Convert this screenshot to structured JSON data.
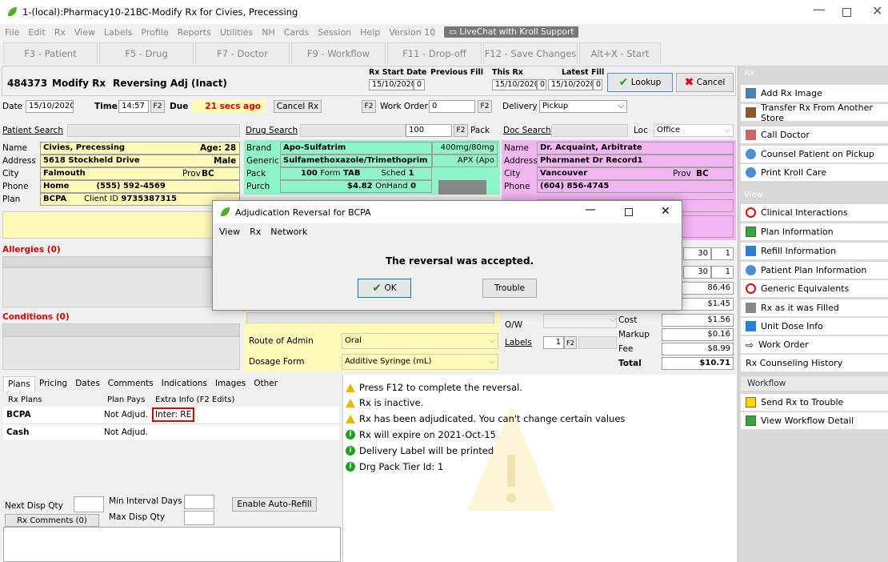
{
  "window": {
    "title": "1-(local):Pharmacy10-21BC-Modify Rx for Civies, Precessing"
  },
  "menu": [
    "File",
    "Edit",
    "Rx",
    "View",
    "Labels",
    "Profile",
    "Reports",
    "Utilities",
    "NH",
    "Cards",
    "Session",
    "Help",
    "Version 10"
  ],
  "livechat": "LiveChat with Kroll Support",
  "fkeys": [
    "F3 - Patient",
    "F5 - Drug",
    "F7 - Doctor",
    "F9 - Workflow",
    "F11 - Drop-off",
    "F12 - Save Changes",
    "Alt+X - Start"
  ],
  "header": {
    "rxnum": "484373",
    "mode": "Modify Rx",
    "status": "Reversing Adj (Inact)",
    "rx_start_label": "Rx Start Date",
    "rx_start": "15/10/2020",
    "rx_start_n": "0",
    "prev_fill_label": "Previous Fill",
    "this_rx_label": "This Rx",
    "this_rx": "15/10/2020",
    "this_rx_n": "0",
    "latest_fill_label": "Latest Fill",
    "latest_fill": "15/10/2020",
    "latest_fill_n": "0",
    "lookup": "Lookup",
    "cancel": "Cancel"
  },
  "row2": {
    "date_label": "Date",
    "date": "15/10/2020",
    "time_label": "Time",
    "time": "14:57",
    "f2": "F2",
    "due_label": "Due",
    "due": "21 secs ago",
    "cancel_rx": "Cancel Rx",
    "work_order_label": "Work Order",
    "work_order": "0",
    "delivery_label": "Delivery",
    "delivery": "Pickup"
  },
  "patient": {
    "search": "Patient Search",
    "name_label": "Name",
    "name": "Civies, Precessing",
    "age": "Age: 28",
    "address_label": "Address",
    "address": "5618 Stockheld Drive",
    "sex": "Male",
    "city_label": "City",
    "city": "Falmouth",
    "prov_label": "Prov",
    "prov": "BC",
    "phone_label": "Phone",
    "phone_type": "Home",
    "phone": "(555) 592-4569",
    "plan_label": "Plan",
    "plan": "BCPA",
    "client_label": "Client ID",
    "client_id": "9735387315"
  },
  "allergies": "Allergies (0)",
  "conditions": "Conditions (0)",
  "drug": {
    "search": "Drug Search",
    "qty": "100",
    "f2": "F2",
    "pack_label": "Pack",
    "brand_label": "Brand",
    "brand": "Apo-Sulfatrim",
    "strength": "400mg/80mg",
    "generic_label": "Generic",
    "generic": "Sulfamethoxazole/Trimethoprim",
    "apx": "APX (Apo",
    "pack2_label": "Pack",
    "pack_size": "100",
    "form_label": "Form",
    "form": "TAB",
    "sched_label": "Sched",
    "sched": "1",
    "purch_label": "Purch",
    "purch": "$4.82",
    "onhand_label": "OnHand",
    "onhand": "0",
    "route_label": "Route of Admin",
    "route": "Oral",
    "dosage_label": "Dosage Form",
    "dosage": "Additive Syringe (mL)"
  },
  "doctor": {
    "search": "Doc Search",
    "loc_label": "Loc",
    "loc": "Office",
    "name_label": "Name",
    "name": "Dr. Acquaint, Arbitrate",
    "address_label": "Address",
    "address": "Pharmanet Dr Record1",
    "city_label": "City",
    "city": "Vancouver",
    "prov_label": "Prov",
    "prov": "BC",
    "phone_label": "Phone",
    "phone": "(604) 856-4745"
  },
  "pricing": {
    "q1": "30",
    "q1b": "1",
    "q2": "30",
    "q2b": "1",
    "p1": "86.46",
    "p2": "$1.45",
    "ow_label": "O/W",
    "cost_label": "Cost",
    "cost": "$1.56",
    "markup_label": "Markup",
    "markup": "$0.16",
    "labels_label": "Labels",
    "labels": "1",
    "fee_label": "Fee",
    "fee": "$8.99",
    "total_label": "Total",
    "total": "$10.71"
  },
  "tabs": [
    "Plans",
    "Pricing",
    "Dates",
    "Comments",
    "Indications",
    "Images",
    "Other"
  ],
  "plans": {
    "col1": "Rx Plans",
    "col2": "Plan Pays",
    "col3": "Extra Info (F2 Edits)",
    "rows": [
      {
        "plan": "BCPA",
        "pays": "Not Adjud.",
        "extra": "Inter: RE"
      },
      {
        "plan": "Cash",
        "pays": "Not Adjud.",
        "extra": ""
      }
    ],
    "next_disp": "Next Disp Qty",
    "min_interval": "Min Interval Days",
    "max_disp": "Max Disp Qty",
    "auto_refill": "Enable Auto-Refill",
    "rx_comments": "Rx Comments (0)"
  },
  "messages": [
    {
      "type": "warn",
      "text": "Press F12 to complete the reversal."
    },
    {
      "type": "warn",
      "text": "Rx is inactive."
    },
    {
      "type": "warn",
      "text": "Rx has been adjudicated. You can't change certain values"
    },
    {
      "type": "info",
      "text": "Rx will expire on 2021-Oct-15"
    },
    {
      "type": "info",
      "text": "Delivery Label will be printed"
    },
    {
      "type": "info",
      "text": "Drg Pack Tier Id: 1"
    }
  ],
  "sidebar": {
    "rx_title": "Rx",
    "rx_items": [
      "Add Rx Image",
      "Transfer Rx From Another Store",
      "Call Doctor",
      "Counsel Patient on Pickup",
      "Print Kroll Care"
    ],
    "view_title": "View",
    "view_items": [
      "Clinical Interactions",
      "Plan Information",
      "Refill Information",
      "Patient Plan Information",
      "Generic Equivalents",
      "Rx as it was Filled",
      "Unit Dose Info",
      "Work Order",
      "Rx Counseling History"
    ],
    "wf_title": "Workflow",
    "wf_items": [
      "Send Rx to Trouble",
      "View Workflow Detail"
    ]
  },
  "dialog": {
    "title": "Adjudication Reversal for BCPA",
    "menu": [
      "View",
      "Rx",
      "Network"
    ],
    "message": "The reversal was accepted.",
    "ok": "OK",
    "trouble": "Trouble"
  }
}
